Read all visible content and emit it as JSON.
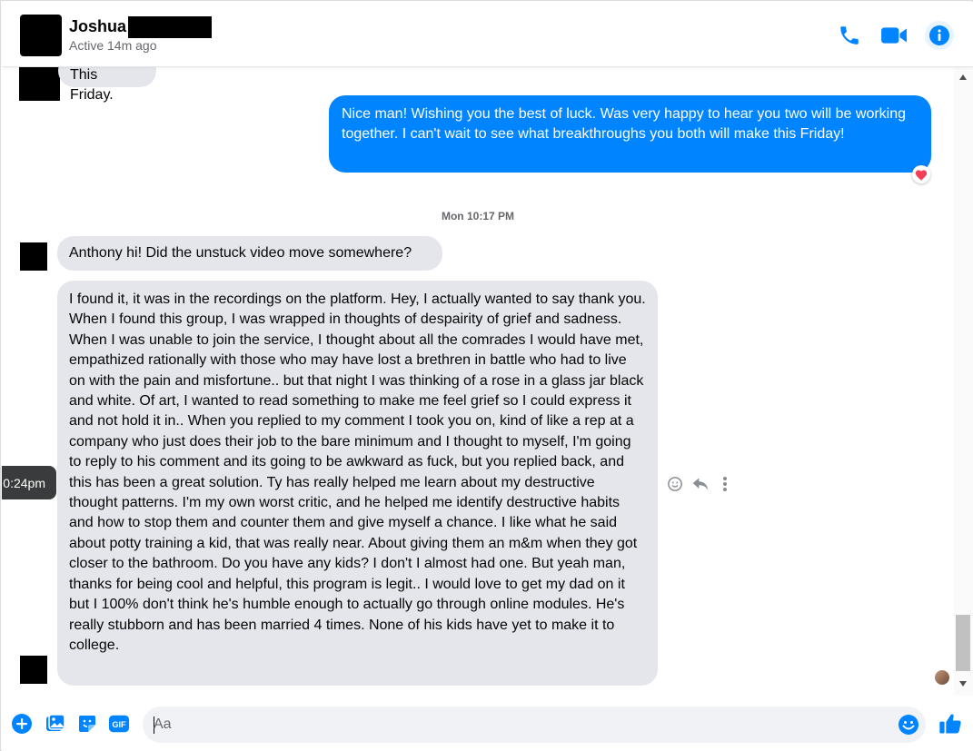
{
  "header": {
    "contact_name": "Joshua",
    "status": "Active 14m ago",
    "icons": [
      "phone-icon",
      "video-camera-icon",
      "info-icon"
    ]
  },
  "colors": {
    "accent": "#0084ff",
    "incoming_bubble": "#e4e6eb",
    "heart": "#f33e58"
  },
  "conversation": {
    "prev_incoming_text": "This Friday.",
    "outgoing_text": "Nice man! Wishing you the best of luck. Was very happy to hear you two will be working together. I can't wait to see what breakthroughs you both will make this Friday!",
    "outgoing_reaction": "heart",
    "timestamp": "Mon 10:17 PM",
    "incoming_short": "Anthony hi! Did the unstuck video move somewhere?",
    "incoming_long": "I found it, it was in the recordings on the platform. Hey, I actually wanted to say thank you. When I found this group, I was wrapped in thoughts of despairity of grief and sadness. When I was unable to join the service, I thought about all the comrades I would have met, empathized rationally with those who may have lost a brethren in battle who had to live on with the pain and misfortune.. but that night I was thinking of a rose in a glass jar black and white. Of art, I wanted to read something to make me feel grief so I could express it and not hold it in.. When you replied to my comment I took you on, kind of like a rep at a company who just does their job to the bare minimum and I thought to myself, I'm going to reply to his comment and its going to be awkward as fuck, but you replied back, and this has been a great solution. Ty has really helped me learn about my destructive thought patterns. I'm my own worst critic, and he helped me identify destructive habits and how to stop them and counter them and give myself a chance. I like what he said about potty training a kid, that was really near. About giving them an m&m when they got closer to the bathroom. Do you have any kids? I don't I almost had one. But yeah man, thanks for being cool and helpful, this program is legit.. I would love to get my dad on it but I 100% don't think he's humble enough to actually go through online modules. He's really stubborn and has been married 4 times. None of his kids have yet to make it to college.",
    "hover_time_tooltip": "0:24pm",
    "message_actions": [
      "emoji-react-icon",
      "reply-icon",
      "more-options-icon"
    ]
  },
  "composer": {
    "placeholder": "Aa",
    "value": "",
    "icons": [
      "plus-icon",
      "photo-icon",
      "sticker-icon",
      "gif-icon",
      "emoji-icon",
      "thumbs-up-icon"
    ],
    "gif_label": "GIF"
  }
}
